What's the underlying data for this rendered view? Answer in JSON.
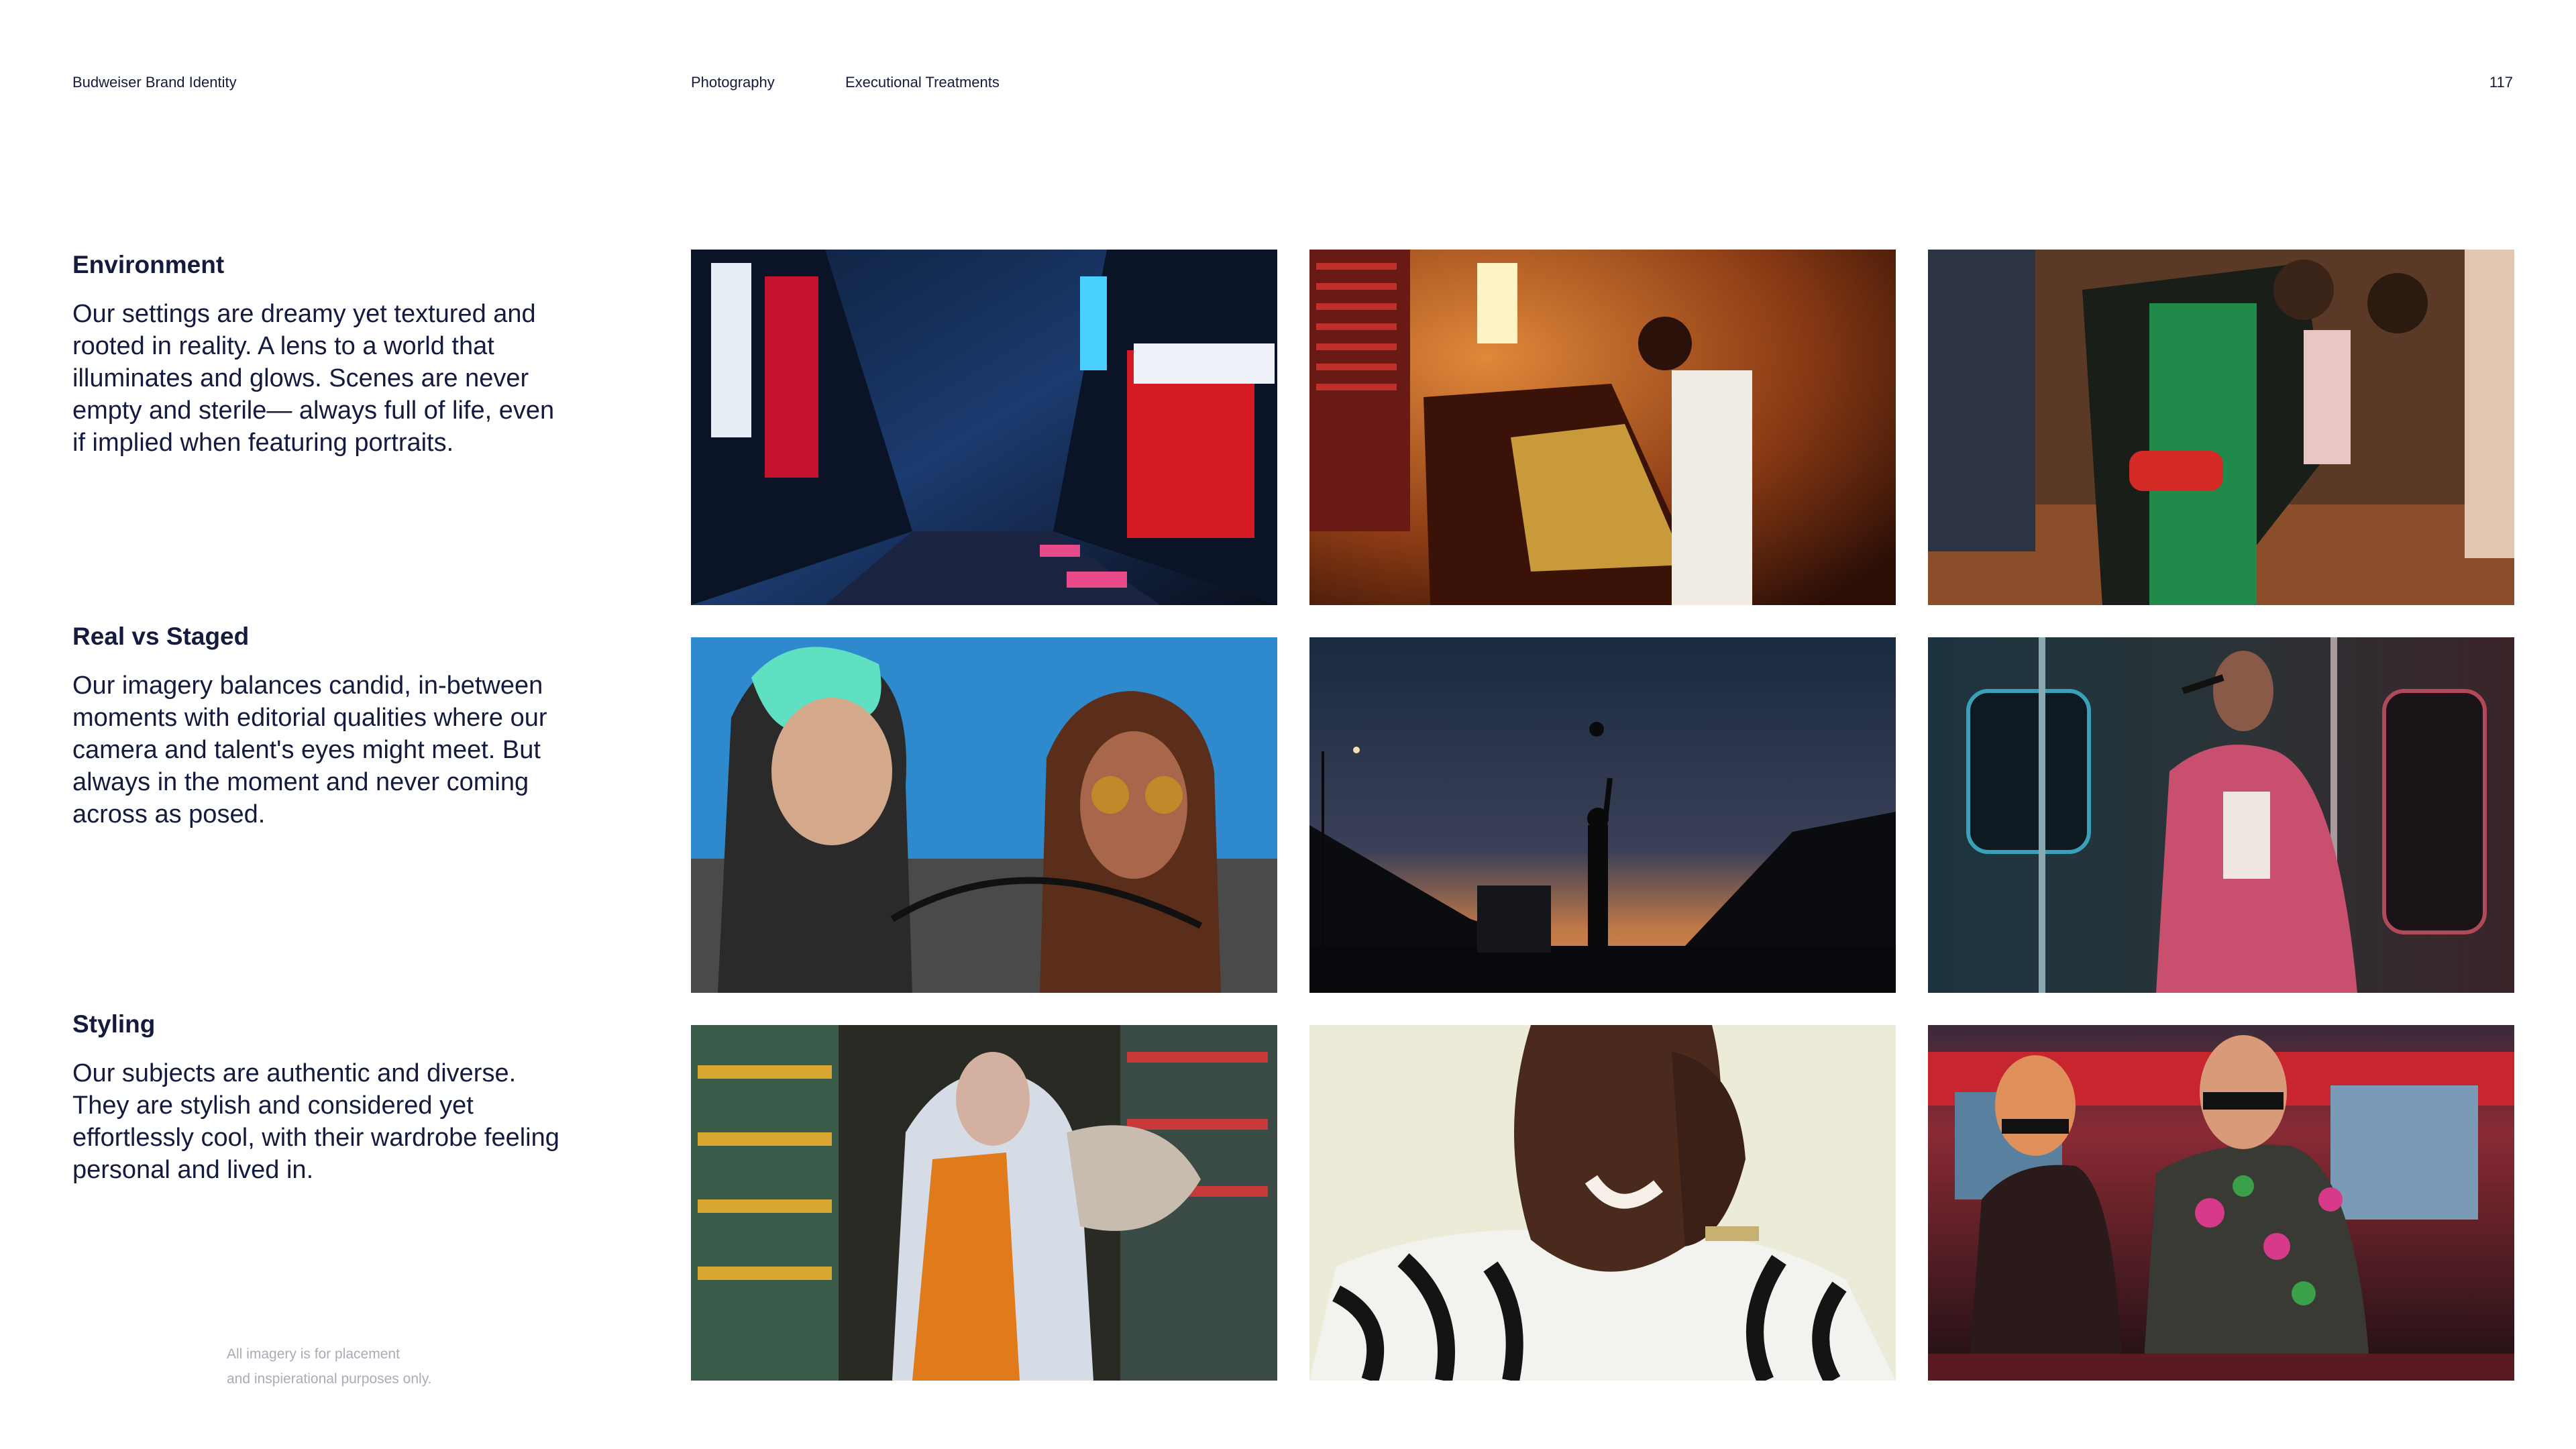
{
  "header": {
    "doc_title": "Budweiser Brand Identity",
    "section": "Photography",
    "subsection": "Executional Treatments",
    "page_number": "117"
  },
  "sections": [
    {
      "title": "Environment",
      "body": "Our settings are dreamy yet textured and rooted in reality. A lens to a world that illuminates and glows. Scenes are never empty and sterile— always full of life, even if implied when featuring portraits."
    },
    {
      "title": "Real vs Staged",
      "body": "Our imagery balances candid, in-between moments with editorial qualities where our camera and talent's eyes might meet. But always in the moment and never coming across as posed."
    },
    {
      "title": "Styling",
      "body": "Our subjects are authentic and diverse. They are stylish and considered yet effortlessly cool, with their wardrobe feeling personal and lived in."
    }
  ],
  "footnote": {
    "line1": "All imagery is for placement",
    "line2": "and inspierational purposes only."
  },
  "colors": {
    "text": "#141b3c",
    "muted": "#a9abb8",
    "background": "#ffffff"
  }
}
